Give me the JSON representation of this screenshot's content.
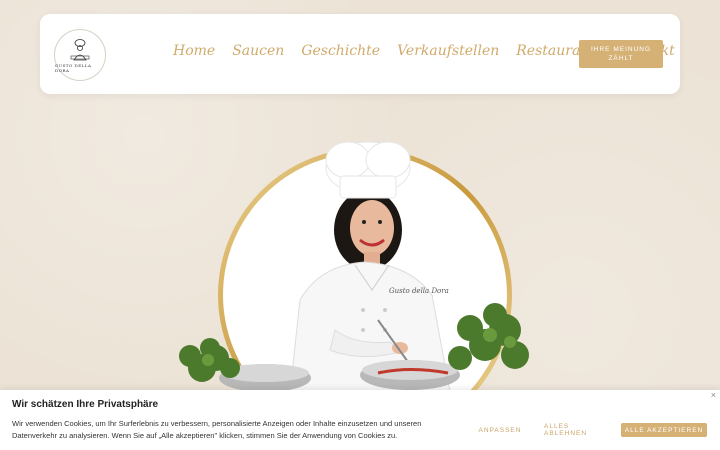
{
  "logo": {
    "text": "GUSTO DELLA DORA"
  },
  "nav": {
    "items": [
      {
        "label": "Home"
      },
      {
        "label": "Saucen"
      },
      {
        "label": "Geschichte"
      },
      {
        "label": "Verkaufstellen"
      },
      {
        "label": "Restaurants"
      },
      {
        "label": "Kontakt"
      }
    ]
  },
  "cta": {
    "label": "IHRE MEINUNG ZÄHLT"
  },
  "hero": {
    "apron_text": "Gusto della Dora"
  },
  "cookie": {
    "title": "Wir schätzen Ihre Privatsphäre",
    "text": "Wir verwenden Cookies, um Ihr Surferlebnis zu verbessern, personalisierte Anzeigen oder Inhalte einzusetzen und unseren Datenverkehr zu analysieren. Wenn Sie auf „Alle akzeptieren\" klicken, stimmen Sie der Anwendung von Cookies zu.",
    "customize": "ANPASSEN",
    "reject": "ALLES ABLEHNEN",
    "accept": "ALLE AKZEPTIEREN",
    "close": "×"
  },
  "colors": {
    "accent": "#d6b176",
    "background": "#ece3d6"
  }
}
